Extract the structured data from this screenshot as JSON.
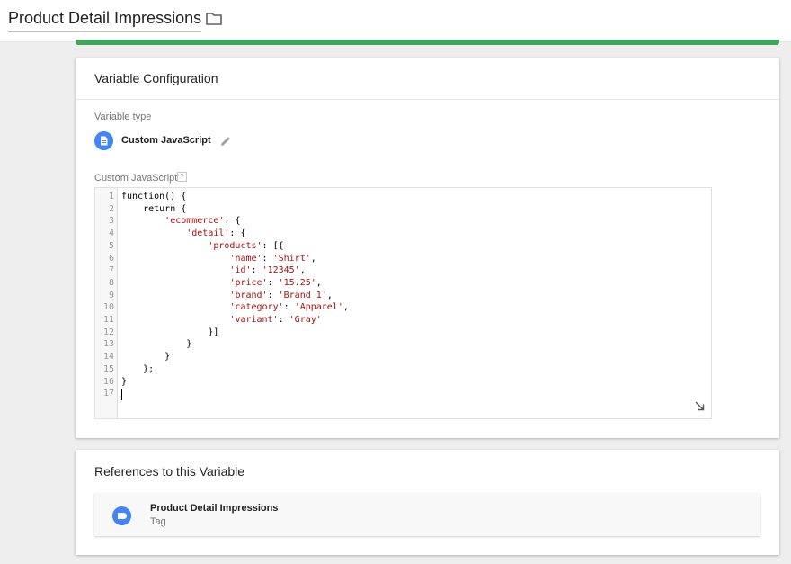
{
  "header": {
    "title": "Product Detail Impressions",
    "folder_icon": "folder-icon"
  },
  "colors": {
    "accent_green": "#3fa65b",
    "icon_blue": "#4285f4",
    "string_red": "#a11111",
    "keyword_purple": "#770088"
  },
  "config": {
    "heading": "Variable Configuration",
    "variable_type_label": "Variable type",
    "variable_type_name": "Custom JavaScript",
    "variable_type_icon": "document-icon",
    "code_label": "Custom JavaScript",
    "help_text": "?",
    "code_lines": [
      [
        [
          "kw",
          "function"
        ],
        [
          "p",
          "() {"
        ]
      ],
      [
        [
          "p",
          "    "
        ],
        [
          "kw",
          "return"
        ],
        [
          "p",
          " {"
        ]
      ],
      [
        [
          "p",
          "        "
        ],
        [
          "s",
          "'ecommerce'"
        ],
        [
          "p",
          ": {"
        ]
      ],
      [
        [
          "p",
          "            "
        ],
        [
          "s",
          "'detail'"
        ],
        [
          "p",
          ": {"
        ]
      ],
      [
        [
          "p",
          "                "
        ],
        [
          "s",
          "'products'"
        ],
        [
          "p",
          ": [{"
        ]
      ],
      [
        [
          "p",
          "                    "
        ],
        [
          "s",
          "'name'"
        ],
        [
          "p",
          ": "
        ],
        [
          "s",
          "'Shirt'"
        ],
        [
          "p",
          ","
        ]
      ],
      [
        [
          "p",
          "                    "
        ],
        [
          "s",
          "'id'"
        ],
        [
          "p",
          ": "
        ],
        [
          "s",
          "'12345'"
        ],
        [
          "p",
          ","
        ]
      ],
      [
        [
          "p",
          "                    "
        ],
        [
          "s",
          "'price'"
        ],
        [
          "p",
          ": "
        ],
        [
          "s",
          "'15.25'"
        ],
        [
          "p",
          ","
        ]
      ],
      [
        [
          "p",
          "                    "
        ],
        [
          "s",
          "'brand'"
        ],
        [
          "p",
          ": "
        ],
        [
          "s",
          "'Brand_1'"
        ],
        [
          "p",
          ","
        ]
      ],
      [
        [
          "p",
          "                    "
        ],
        [
          "s",
          "'category'"
        ],
        [
          "p",
          ": "
        ],
        [
          "s",
          "'Apparel'"
        ],
        [
          "p",
          ","
        ]
      ],
      [
        [
          "p",
          "                    "
        ],
        [
          "s",
          "'variant'"
        ],
        [
          "p",
          ": "
        ],
        [
          "s",
          "'Gray'"
        ]
      ],
      [
        [
          "p",
          "                }]"
        ]
      ],
      [
        [
          "p",
          "            }"
        ]
      ],
      [
        [
          "p",
          "        }"
        ]
      ],
      [
        [
          "p",
          "    };"
        ]
      ],
      [
        [
          "p",
          "}"
        ]
      ],
      []
    ]
  },
  "references": {
    "heading": "References to this Variable",
    "items": [
      {
        "name": "Product Detail Impressions",
        "type": "Tag",
        "icon": "tag-icon"
      }
    ]
  }
}
